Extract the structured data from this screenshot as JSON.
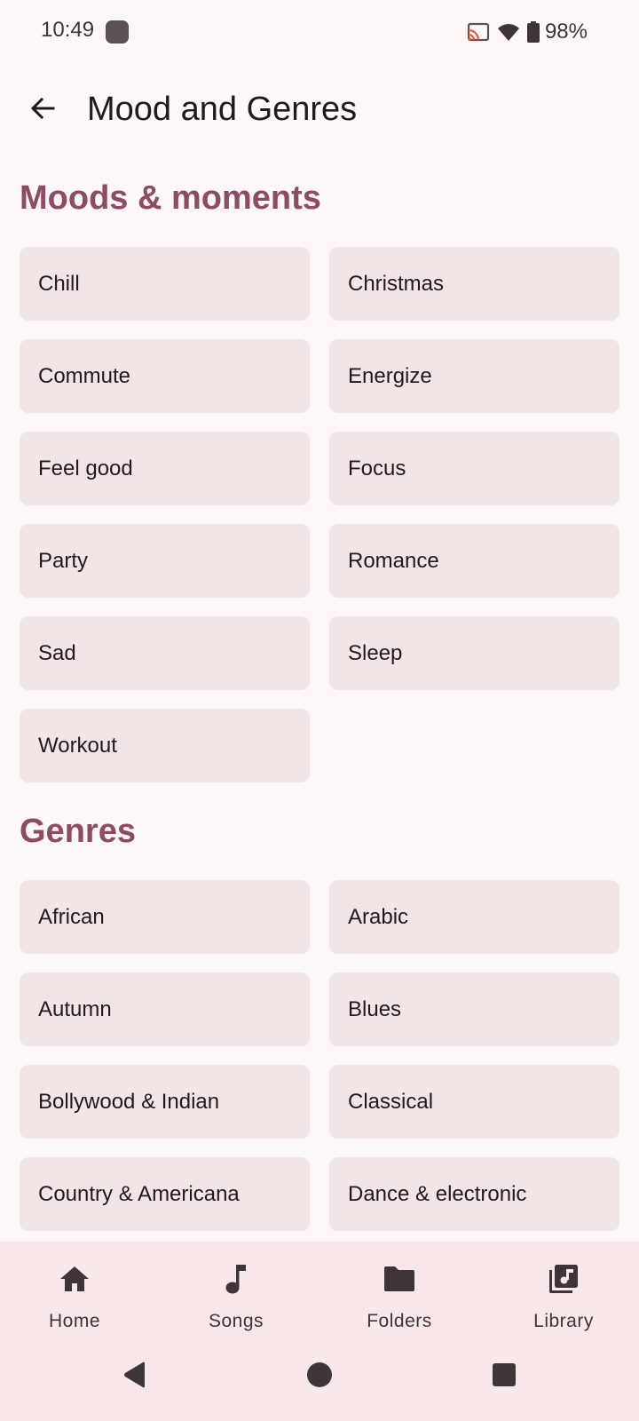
{
  "status_bar": {
    "time": "10:49",
    "battery": "98%"
  },
  "app_bar": {
    "title": "Mood and Genres",
    "back_icon": "arrow-back-icon"
  },
  "sections": {
    "moods": {
      "title": "Moods & moments",
      "items": [
        "Chill",
        "Christmas",
        "Commute",
        "Energize",
        "Feel good",
        "Focus",
        "Party",
        "Romance",
        "Sad",
        "Sleep",
        "Workout"
      ]
    },
    "genres": {
      "title": "Genres",
      "items": [
        "African",
        "Arabic",
        "Autumn",
        "Blues",
        "Bollywood & Indian",
        "Classical",
        "Country & Americana",
        "Dance & electronic"
      ]
    }
  },
  "bottom_nav": {
    "items": [
      {
        "label": "Home",
        "icon": "home-icon"
      },
      {
        "label": "Songs",
        "icon": "music-note-icon"
      },
      {
        "label": "Folders",
        "icon": "folder-icon"
      },
      {
        "label": "Library",
        "icon": "library-music-icon"
      }
    ]
  },
  "colors": {
    "background": "#fdf7f7",
    "accent": "#8e4b64",
    "tile": "#f2e5e6",
    "nav_bar": "#f9e8ea"
  }
}
